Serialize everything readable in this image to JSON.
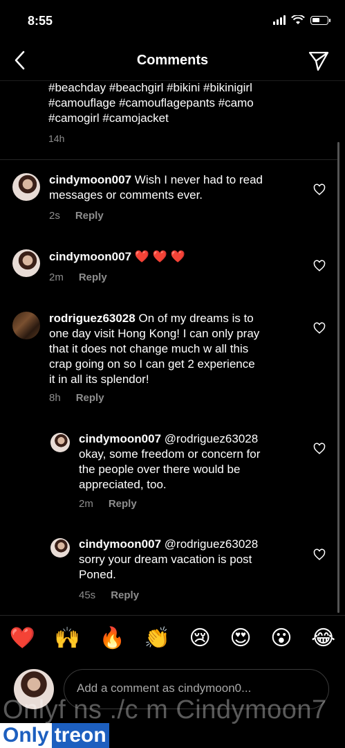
{
  "status": {
    "time": "8:55"
  },
  "header": {
    "title": "Comments"
  },
  "caption": {
    "line1": "#beachday #beachgirl #bikini #bikinigirl",
    "line2": "#camouflage #camouflagepants #camo",
    "line3": "#camogirl #camojacket",
    "time": "14h"
  },
  "comments": [
    {
      "user": "cindymoon007",
      "lines": [
        "Wish I never had to read",
        "messages or comments ever."
      ],
      "time": "2s",
      "reply": "Reply"
    },
    {
      "user": "cindymoon007",
      "text": "❤️ ❤️ ❤️",
      "time": "2m",
      "reply": "Reply"
    },
    {
      "user": "rodriguez63028",
      "lines": [
        "On of my dreams is to",
        "one day visit Hong Kong! I can only pray",
        "that it does not change much w all this",
        "crap going on so I can get 2 experience",
        "it in all its splendor!"
      ],
      "time": "8h",
      "reply": "Reply"
    },
    {
      "user": "cindymoon007",
      "lines": [
        "@rodriguez63028",
        "okay, some freedom or concern for",
        "the people over there would be",
        "appreciated, too."
      ],
      "time": "2m",
      "reply": "Reply"
    },
    {
      "user": "cindymoon007",
      "lines": [
        "@rodriguez63028",
        "sorry your dream vacation is post",
        "Poned."
      ],
      "time": "45s",
      "reply": "Reply"
    }
  ],
  "emojis": [
    "❤️",
    "🙌",
    "🔥",
    "👏",
    "😢",
    "😍",
    "😮",
    "😂"
  ],
  "input": {
    "placeholder": "Add a comment as cindymoon0..."
  },
  "watermark": "Onlyf ns ./c m Cindymoon7",
  "brand": {
    "part1": "Only",
    "part2": "treon"
  }
}
